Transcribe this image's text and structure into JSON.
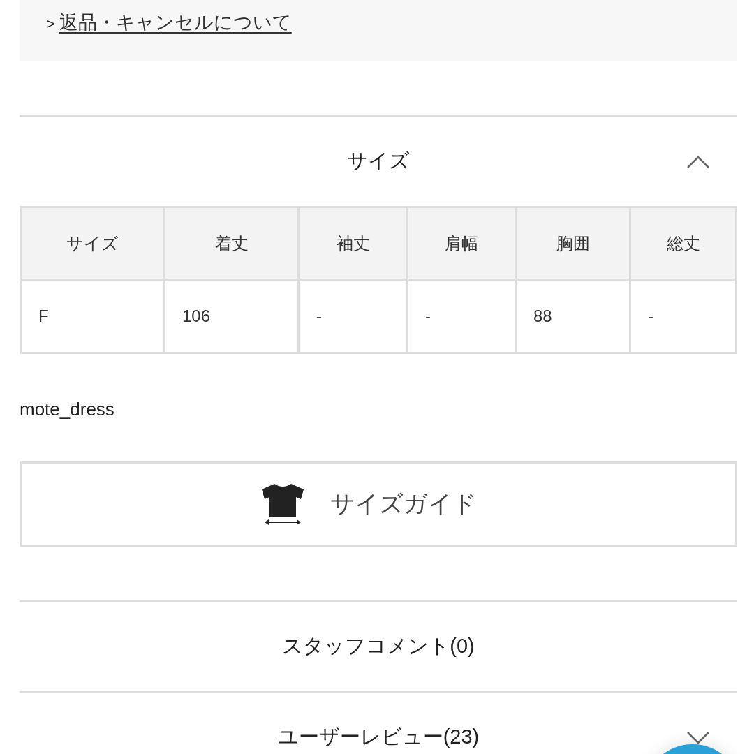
{
  "info_box": {
    "marker": ">",
    "link": "返品・キャンセルについて"
  },
  "size_section": {
    "title": "サイズ",
    "expanded": true,
    "table": {
      "columns": [
        "サイズ",
        "着丈",
        "袖丈",
        "肩幅",
        "胸囲",
        "総丈"
      ],
      "rows": [
        [
          "F",
          "106",
          "-",
          "-",
          "88",
          "-"
        ]
      ]
    },
    "note": "mote_dress",
    "size_guide_button": "サイズガイド"
  },
  "staff_comments": {
    "title": "スタッフコメント(0)"
  },
  "user_reviews": {
    "title": "ユーザーレビュー(23)",
    "expanded": false
  }
}
